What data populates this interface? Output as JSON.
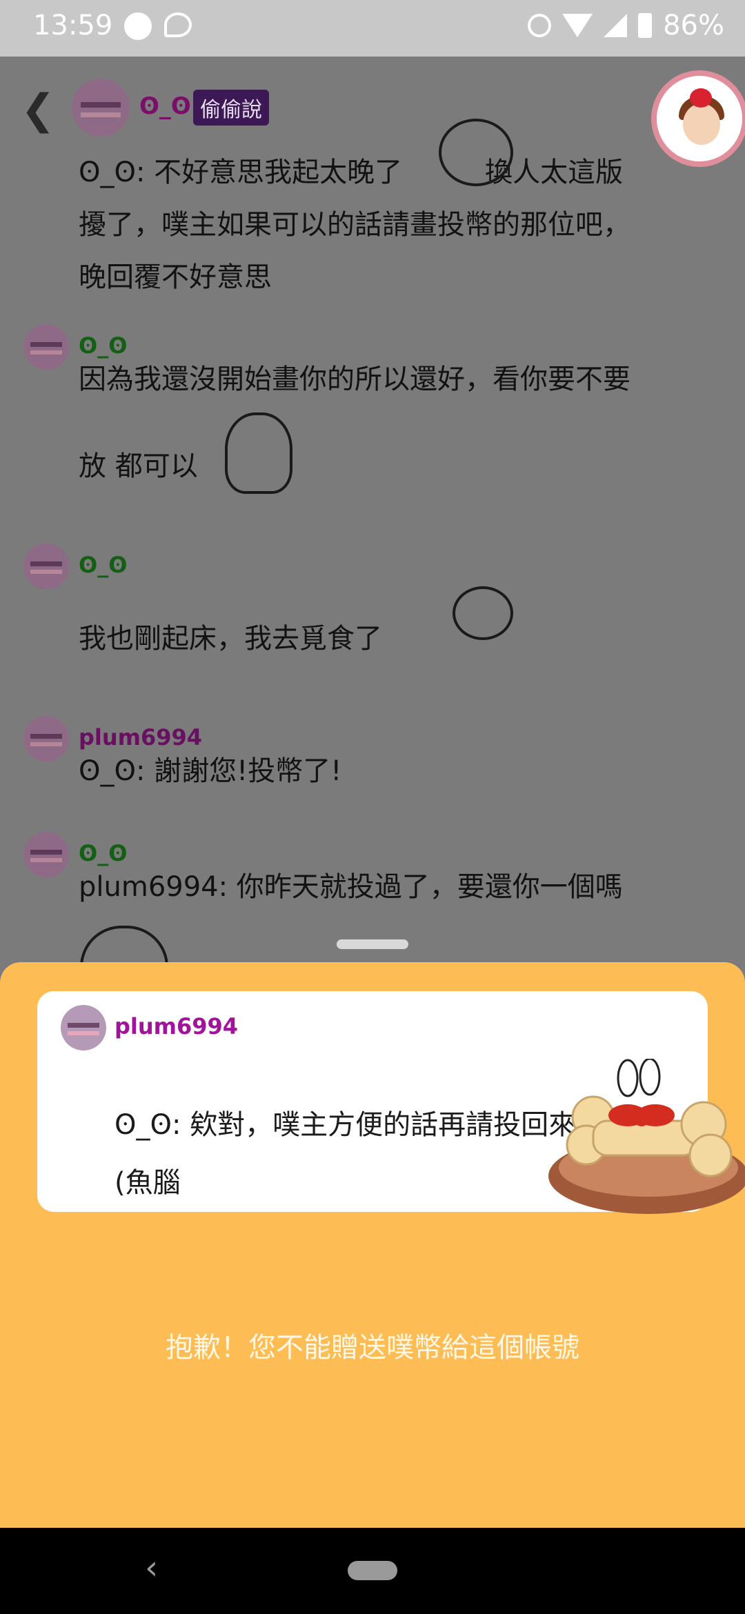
{
  "status_bar": {
    "time": "13:59",
    "battery": "86%",
    "icons": [
      "fox-icon",
      "messenger-icon",
      "alarm-icon",
      "wifi-icon",
      "signal-icon",
      "battery-icon"
    ]
  },
  "header": {
    "name": "ʘ_ʘ",
    "badge": "偷偷說",
    "back_icon": "chevron-left-icon"
  },
  "messages": [
    {
      "text_lines": [
        "ʘ_ʘ: 不好意思我起太晚了",
        "換人太這版",
        "擾了，噗主如果可以的話請畫投幣的那位吧，",
        "晚回覆不好意思"
      ]
    },
    {
      "name": "ʘ_ʘ",
      "text_lines": [
        "因為我還沒開始畫你的所以還好，看你要不要",
        "放 都可以"
      ]
    },
    {
      "name": "ʘ_ʘ",
      "text_lines": [
        "我也剛起床，我去覓食了"
      ]
    },
    {
      "name": "plum6994",
      "text_lines": [
        "ʘ_ʘ: 謝謝您!投幣了!"
      ]
    },
    {
      "name": "ʘ_ʘ",
      "text_lines": [
        "plum6994: 你昨天就投過了，要還你一個嗎"
      ]
    }
  ],
  "sheet": {
    "card_name": "plum6994",
    "card_lines": [
      "ʘ_ʘ: 欸對，噗主方便的話再請投回來",
      "(魚腦"
    ],
    "message": "抱歉！您不能贈送噗幣給這個帳號"
  },
  "colors": {
    "sheet_bg": "#febd54",
    "name_green": "#155e16",
    "name_purple": "#a1139a",
    "badge_bg": "#3c1854"
  }
}
